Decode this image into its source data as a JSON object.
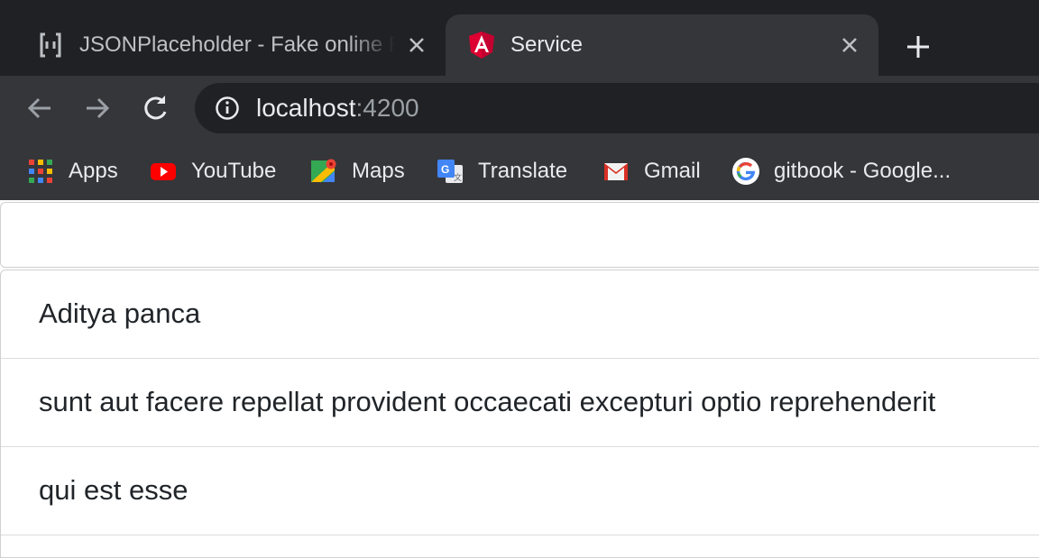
{
  "browser": {
    "tabs": [
      {
        "title": "JSONPlaceholder - Fake online REST API for testing",
        "favicon": "jsonplaceholder-icon",
        "active": false
      },
      {
        "title": "Service",
        "favicon": "angular-icon",
        "active": true
      }
    ],
    "address_bar": {
      "host": "localhost",
      "port": ":4200"
    },
    "bookmarks": [
      {
        "label": "Apps",
        "icon": "apps-grid-icon"
      },
      {
        "label": "YouTube",
        "icon": "youtube-icon"
      },
      {
        "label": "Maps",
        "icon": "maps-icon"
      },
      {
        "label": "Translate",
        "icon": "translate-icon"
      },
      {
        "label": "Gmail",
        "icon": "gmail-icon"
      },
      {
        "label": "gitbook - Google...",
        "icon": "google-icon"
      }
    ]
  },
  "page": {
    "header_card_text": "",
    "items": [
      {
        "text": "Aditya panca"
      },
      {
        "text": "sunt aut facere repellat provident occaecati excepturi optio reprehenderit"
      },
      {
        "text": "qui est esse"
      }
    ]
  },
  "colors": {
    "chrome_dark": "#202124",
    "chrome_toolbar": "#35363a",
    "angular_red": "#dd0031",
    "text": "#212529"
  }
}
